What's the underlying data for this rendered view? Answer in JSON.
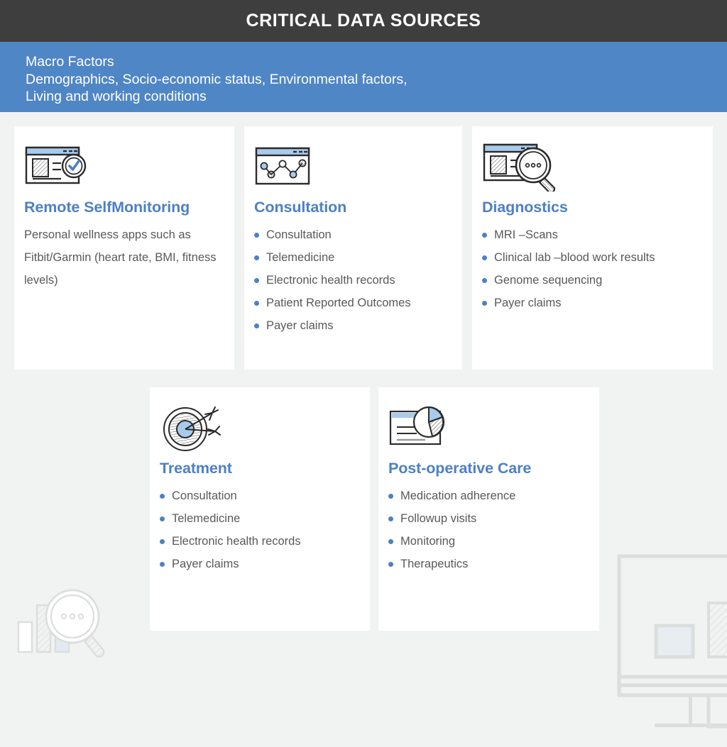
{
  "header": {
    "title": "CRITICAL DATA SOURCES"
  },
  "macro_band": {
    "line1": "Macro Factors",
    "line2": "Demographics, Socio-economic status, Environmental factors,",
    "line3": "Living and working conditions"
  },
  "colors": {
    "header_bg": "#3e3e3e",
    "band_bg": "#4f86c6",
    "accent_blue": "#4d80c4",
    "card_bg": "#ffffff",
    "page_bg": "#f1f2f2",
    "body_text": "#595959",
    "icon_fill_blue": "#a8cbec",
    "watermark": "#dcdedd"
  },
  "cards": [
    {
      "id": "remote-self-monitoring",
      "title": "Remote SelfMonitoring",
      "icon": "browser-document-check-icon",
      "description": "Personal wellness apps such as Fitbit/Garmin (heart rate, BMI, fitness levels)",
      "items": []
    },
    {
      "id": "consultation",
      "title": "Consultation",
      "icon": "browser-line-chart-icon",
      "description": "",
      "items": [
        "Consultation",
        "Telemedicine",
        "Electronic health records",
        "Patient Reported Outcomes",
        "Payer claims"
      ]
    },
    {
      "id": "diagnostics",
      "title": "Diagnostics",
      "icon": "browser-magnifier-icon",
      "description": "",
      "items": [
        "MRI –Scans",
        "Clinical lab –blood work results",
        "Genome sequencing",
        "Payer claims"
      ]
    },
    {
      "id": "treatment",
      "title": "Treatment",
      "icon": "target-arrows-icon",
      "description": "",
      "items": [
        "Consultation",
        "Telemedicine",
        "Electronic health records",
        "Payer claims"
      ]
    },
    {
      "id": "post-operative-care",
      "title": "Post-operative Care",
      "icon": "document-pie-chart-icon",
      "description": "",
      "items": [
        "Medication adherence",
        "Followup visits",
        "Monitoring",
        "Therapeutics"
      ]
    }
  ],
  "watermarks": [
    {
      "id": "bar-chart-magnifier-watermark",
      "icon": "bar-chart-magnifier-icon"
    },
    {
      "id": "monitor-watermark",
      "icon": "monitor-screen-icon"
    }
  ]
}
